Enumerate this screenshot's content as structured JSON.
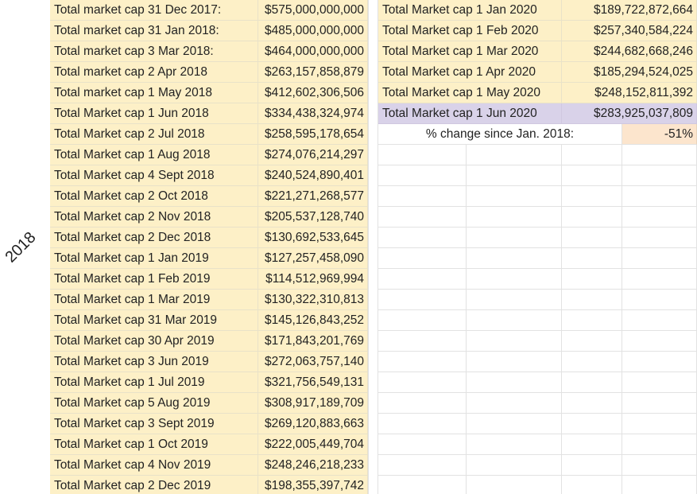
{
  "side_label": "2018",
  "left_rows": [
    {
      "label": "Total market cap 31 Dec 2017:",
      "value": "$575,000,000,000"
    },
    {
      "label": "Total market cap 31 Jan 2018:",
      "value": "$485,000,000,000"
    },
    {
      "label": "Total market cap 3 Mar 2018:",
      "value": "$464,000,000,000"
    },
    {
      "label": "Total market cap 2 Apr 2018",
      "value": "$263,157,858,879"
    },
    {
      "label": "Total market cap 1 May 2018",
      "value": "$412,602,306,506"
    },
    {
      "label": "Total Market cap 1 Jun 2018",
      "value": "$334,438,324,974"
    },
    {
      "label": "Total Market cap 2 Jul 2018",
      "value": "$258,595,178,654"
    },
    {
      "label": "Total Market cap 1 Aug 2018",
      "value": "$274,076,214,297"
    },
    {
      "label": "Total Market cap 4 Sept 2018",
      "value": "$240,524,890,401"
    },
    {
      "label": "Total Market cap 2 Oct 2018",
      "value": "$221,271,268,577"
    },
    {
      "label": "Total Market cap 2 Nov 2018",
      "value": "$205,537,128,740"
    },
    {
      "label": "Total Market cap 2 Dec 2018",
      "value": "$130,692,533,645"
    },
    {
      "label": "Total Market cap 1 Jan 2019",
      "value": "$127,257,458,090"
    },
    {
      "label": "Total Market cap 1 Feb 2019",
      "value": "$114,512,969,994"
    },
    {
      "label": "Total Market cap 1 Mar 2019",
      "value": "$130,322,310,813"
    },
    {
      "label": "Total Market cap 31 Mar 2019",
      "value": "$145,126,843,252"
    },
    {
      "label": "Total Market cap 30 Apr 2019",
      "value": "$171,843,201,769"
    },
    {
      "label": "Total Market cap 3 Jun 2019",
      "value": "$272,063,757,140"
    },
    {
      "label": "Total Market cap 1 Jul 2019",
      "value": "$321,756,549,131"
    },
    {
      "label": "Total Market cap 5 Aug 2019",
      "value": "$308,917,189,709"
    },
    {
      "label": "Total Market cap 3 Sept 2019",
      "value": "$269,120,883,663"
    },
    {
      "label": "Total Market cap 1 Oct 2019",
      "value": "$222,005,449,704"
    },
    {
      "label": "Total Market cap 4 Nov 2019",
      "value": "$248,246,218,233"
    },
    {
      "label": "Total Market cap 2 Dec 2019",
      "value": "$198,355,397,742"
    }
  ],
  "right_rows": [
    {
      "label": "Total Market cap 1 Jan 2020",
      "value": "$189,722,872,664",
      "highlight": false
    },
    {
      "label": "Total Market cap 1 Feb 2020",
      "value": "$257,340,584,224",
      "highlight": false
    },
    {
      "label": "Total Market cap 1 Mar 2020",
      "value": "$244,682,668,246",
      "highlight": false
    },
    {
      "label": "Total Market cap 1 Apr 2020",
      "value": "$185,294,524,025",
      "highlight": false
    },
    {
      "label": "Total Market cap 1 May 2020",
      "value": "$248,152,811,392",
      "highlight": false
    },
    {
      "label": "Total Market cap 1 Jun 2020",
      "value": "$283,925,037,809",
      "highlight": true
    }
  ],
  "pct_change": {
    "label": "% change since Jan. 2018:",
    "value": "-51%"
  },
  "colors": {
    "yellow_fill": "#fdf0c7",
    "purple_fill": "#d9d2e9",
    "peach_fill": "#fce5cd"
  }
}
